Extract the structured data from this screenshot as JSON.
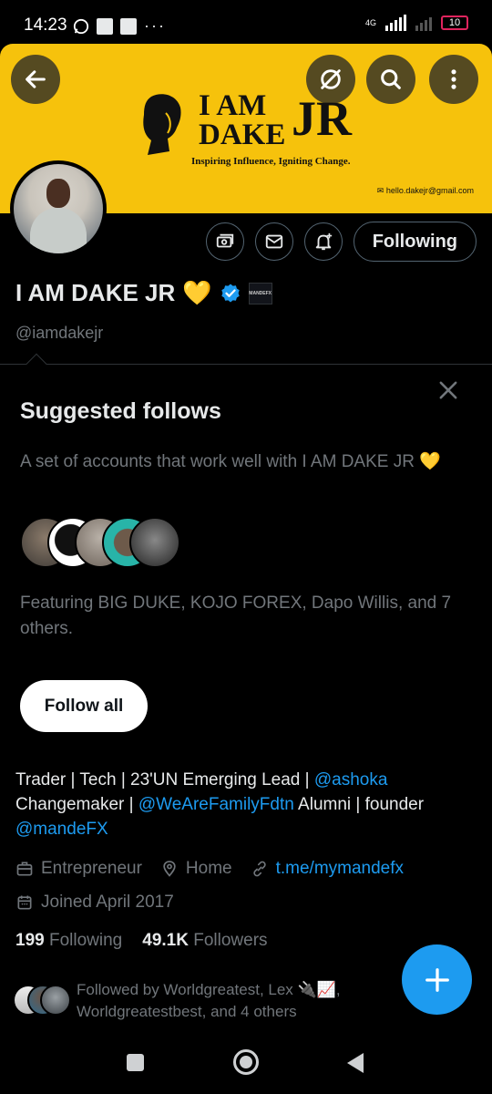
{
  "status_bar": {
    "time": "14:23",
    "network": "4G",
    "battery": "10"
  },
  "banner": {
    "brand_line1": "I AM",
    "brand_line2": "DAKE",
    "brand_jr": "JR",
    "tagline": "Inspiring Influence, Igniting Change.",
    "email": "✉ hello.dakejr@gmail.com",
    "bg_color": "#f6c20c"
  },
  "profile": {
    "name": "I AM DAKE JR",
    "name_emoji": "💛",
    "handle": "@iamdakejr",
    "following_button": "Following",
    "affiliate_badge": "MANDEFX"
  },
  "suggested": {
    "title": "Suggested follows",
    "description": "A set of accounts that work well with I AM DAKE JR 💛",
    "featuring": "Featuring BIG DUKE, KOJO FOREX, Dapo Willis, and 7 others.",
    "follow_all": "Follow all"
  },
  "bio": {
    "part1": "Trader | Tech | 23'UN Emerging Lead | ",
    "link1": "@ashoka",
    "part2": " Changemaker | ",
    "link2": "@WeAreFamilyFdtn",
    "part3": " Alumni | founder ",
    "link3": "@mandeFX"
  },
  "meta": {
    "profession": "Entrepreneur",
    "location": "Home",
    "website": "t.me/mymandefx",
    "joined": "Joined April 2017"
  },
  "stats": {
    "following_count": "199",
    "following_label": "Following",
    "followers_count": "49.1K",
    "followers_label": "Followers"
  },
  "followed_by": {
    "text": "Followed by Worldgreatest, Lex 🔌📈, Worldgreatestbest, and 4 others"
  },
  "colors": {
    "accent": "#1d9bf0",
    "muted": "#71767b",
    "heart": "#f2c12e"
  }
}
